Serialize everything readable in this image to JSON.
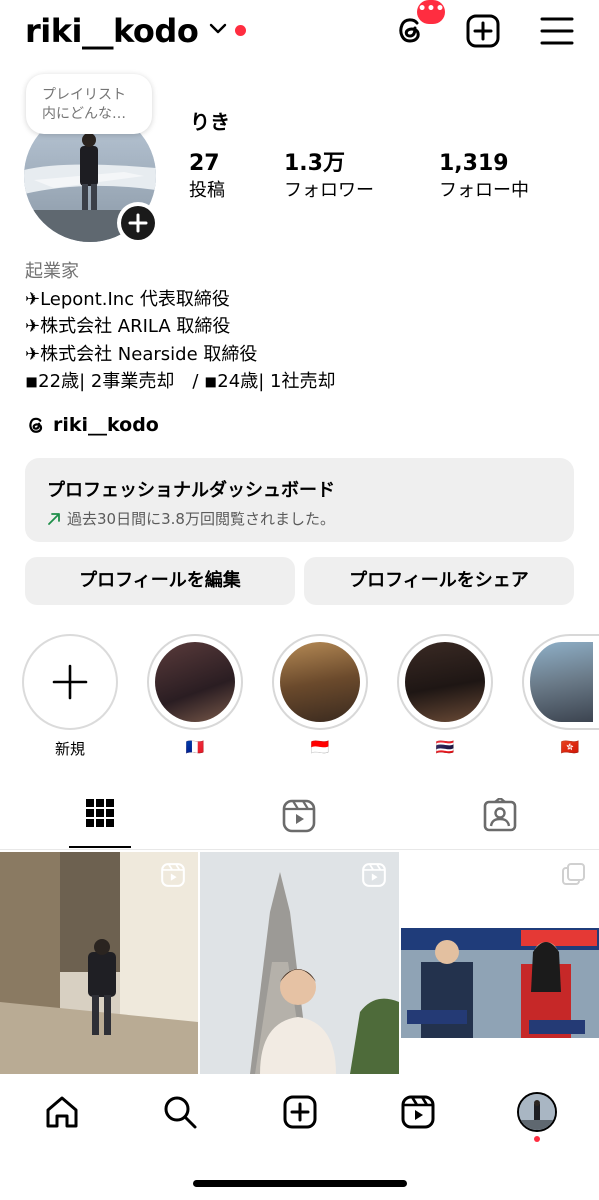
{
  "header": {
    "username": "riki__kodo",
    "icons": [
      "chevron-down-icon",
      "threads-icon",
      "add-post-icon",
      "menu-icon"
    ],
    "threads_badge": "•••"
  },
  "profile": {
    "note": "プレイリスト\n内にどんな…",
    "display_name": "りき",
    "stats": [
      {
        "value": "27",
        "label": "投稿"
      },
      {
        "value": "1.3万",
        "label": "フォロワー"
      },
      {
        "value": "1,319",
        "label": "フォロー中"
      }
    ],
    "bio": {
      "category": "起業家",
      "lines": [
        "✈Lepont.Inc 代表取締役",
        "✈株式会社 ARILA 取締役",
        "✈株式会社 Nearside 取締役",
        "◾22歳| 2事業売却　/ ◾24歳| 1社売却"
      ]
    },
    "threads_handle": "riki__kodo"
  },
  "dashboard": {
    "title": "プロフェッショナルダッシュボード",
    "subtitle": "過去30日間に3.8万回閲覧されました。"
  },
  "buttons": {
    "edit_profile": "プロフィールを編集",
    "share_profile": "プロフィールをシェア"
  },
  "highlights": [
    {
      "label": "新規"
    },
    {
      "label": "🇫🇷"
    },
    {
      "label": "🇮🇩"
    },
    {
      "label": "🇹🇭"
    },
    {
      "label": "🇭🇰"
    }
  ],
  "tabs": [
    "grid-icon",
    "reels-icon",
    "tagged-icon"
  ],
  "bottom_nav": [
    "home-icon",
    "search-icon",
    "create-icon",
    "reels-icon",
    "profile-avatar"
  ],
  "colors": {
    "accent_red": "#ff2d40",
    "button_bg": "#efefef",
    "trend_green": "#1f8f4a"
  }
}
